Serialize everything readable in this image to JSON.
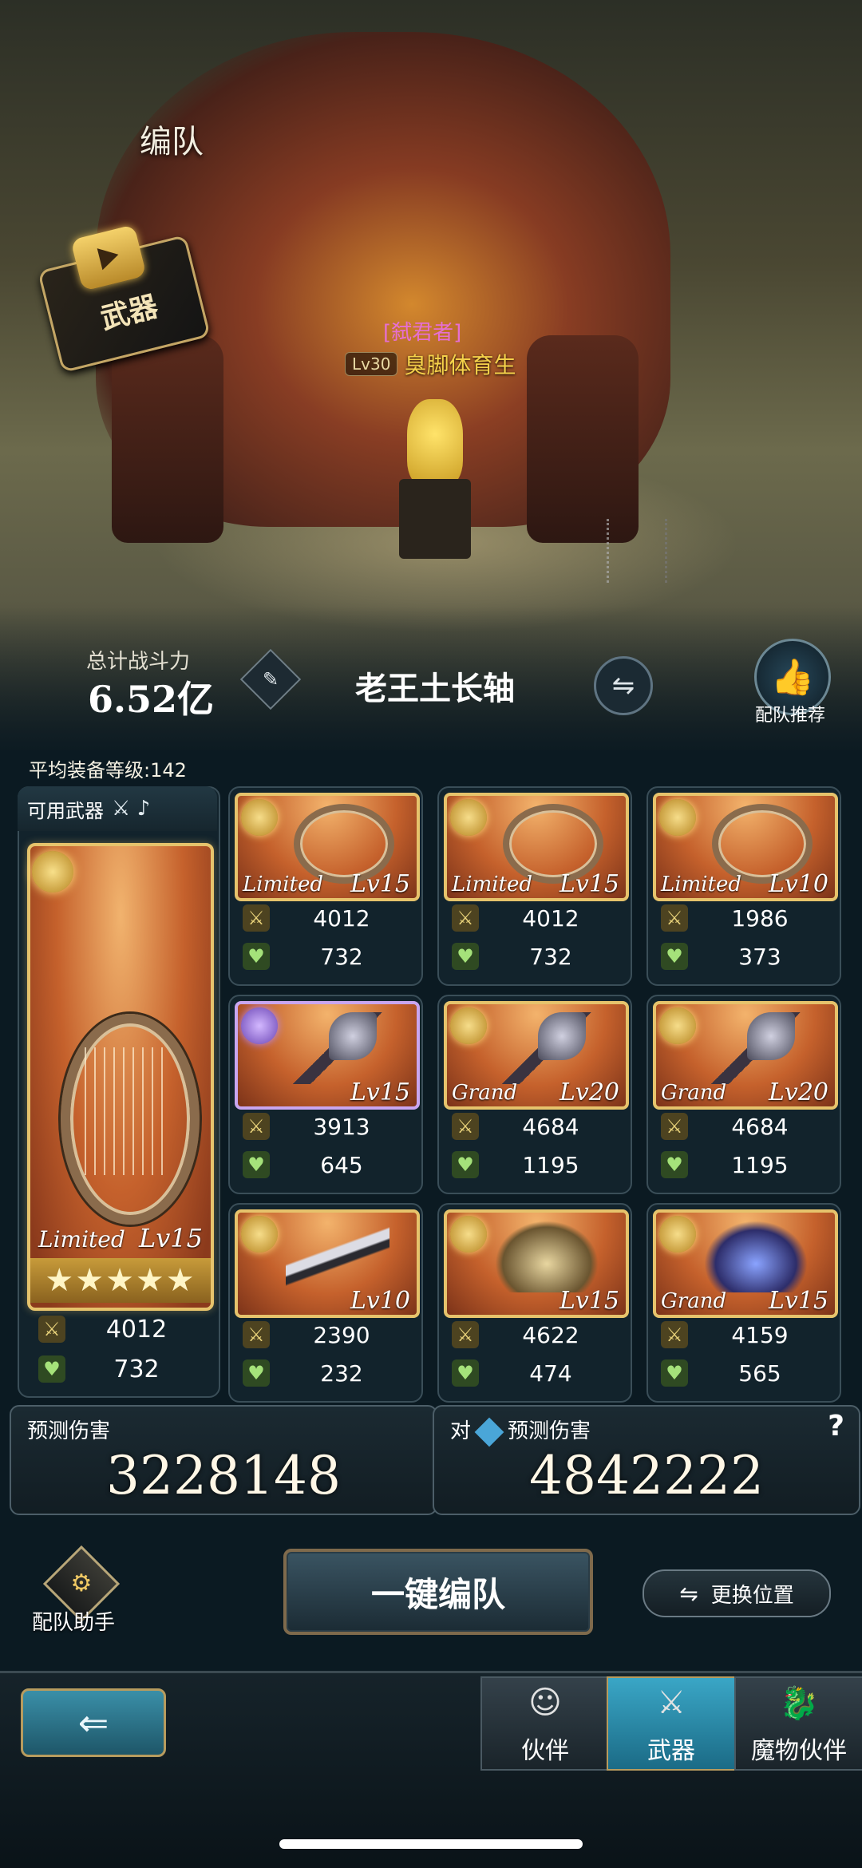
{
  "header": {
    "title": "编队",
    "weapon_tag": "武器"
  },
  "enemy": {
    "title": "[弑君者]",
    "level": "Lv30",
    "name": "臭脚体育生"
  },
  "team": {
    "power_label": "总计战斗力",
    "power_value": "6.52亿",
    "name": "老王土长轴",
    "recommend_label": "配队推荐",
    "feather_icon": "feather-icon",
    "swap_icon": "⇋"
  },
  "avg_level": "平均装备等级:142",
  "available": {
    "label": "可用武器",
    "icons": "⚔ ♪"
  },
  "main_weapon": {
    "tier": "Limited",
    "level": "Lv15",
    "stars": "★★★★★",
    "attack": "4012",
    "hp": "732"
  },
  "slots": [
    {
      "tier": "Limited",
      "level": "Lv15",
      "attack": "4012",
      "hp": "732",
      "art": "harp"
    },
    {
      "tier": "Limited",
      "level": "Lv15",
      "attack": "4012",
      "hp": "732",
      "art": "harp"
    },
    {
      "tier": "Limited",
      "level": "Lv10",
      "attack": "1986",
      "hp": "373",
      "art": "harp"
    },
    {
      "tier": "",
      "level": "Lv15",
      "attack": "3913",
      "hp": "645",
      "art": "axe"
    },
    {
      "tier": "Grand",
      "level": "Lv20",
      "attack": "4684",
      "hp": "1195",
      "art": "axe"
    },
    {
      "tier": "Grand",
      "level": "Lv20",
      "attack": "4684",
      "hp": "1195",
      "art": "axe"
    },
    {
      "tier": "",
      "level": "Lv10",
      "attack": "2390",
      "hp": "232",
      "art": "blade"
    },
    {
      "tier": "",
      "level": "Lv15",
      "attack": "4622",
      "hp": "474",
      "art": "gauntlet"
    },
    {
      "tier": "Grand",
      "level": "Lv15",
      "attack": "4159",
      "hp": "565",
      "art": "claw"
    }
  ],
  "damage": {
    "label": "预测伤害",
    "value": "3228148",
    "vs_prefix": "对",
    "vs_label": "预测伤害",
    "vs_value": "4842222",
    "help": "?"
  },
  "actions": {
    "assist_label": "配队助手",
    "auto_label": "一键编队",
    "swap_label": "更换位置"
  },
  "nav": {
    "back": "⇐",
    "tabs": [
      {
        "label": "伙伴"
      },
      {
        "label": "武器"
      },
      {
        "label": "魔物伙伴"
      }
    ]
  },
  "colors": {
    "gold_border": "#e6c36c",
    "purple_border": "#c9a6f0",
    "active_tab": "#3aa6c6",
    "enemy_title": "#e66fd2",
    "enemy_name": "#f5d14a"
  }
}
